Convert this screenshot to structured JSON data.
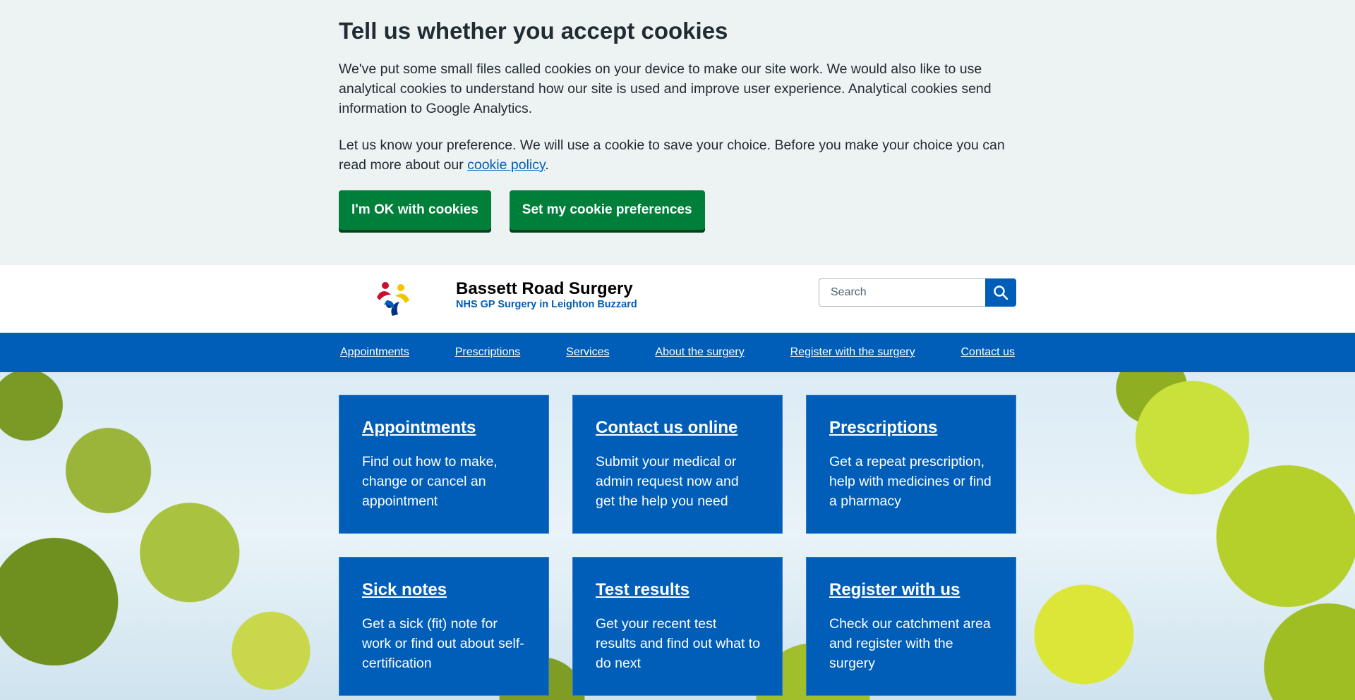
{
  "cookie_banner": {
    "title": "Tell us whether you accept cookies",
    "paragraph1": "We've put some small files called cookies on your device to make our site work. We would also like to use analytical cookies to understand how our site is used and improve user experience. Analytical cookies send information to Google Analytics.",
    "paragraph2_before": "Let us know your preference. We will use a cookie to save your choice. Before you make your choice you can read more about our ",
    "policy_link": "cookie policy",
    "paragraph2_after": ".",
    "accept_button": "I'm OK with cookies",
    "preferences_button": "Set my cookie preferences"
  },
  "header": {
    "title": "Bassett Road Surgery",
    "subtitle": "NHS GP Surgery in Leighton Buzzard",
    "search_placeholder": "Search",
    "logo_icon": "people-logo-icon",
    "search_icon": "search-icon"
  },
  "nav": {
    "items": [
      {
        "label": "Appointments"
      },
      {
        "label": "Prescriptions"
      },
      {
        "label": "Services"
      },
      {
        "label": "About the surgery"
      },
      {
        "label": "Register with the surgery"
      },
      {
        "label": "Contact us"
      }
    ]
  },
  "cards": [
    {
      "title": "Appointments",
      "text": "Find out how to make, change or cancel an appointment"
    },
    {
      "title": "Contact us online",
      "text": "Submit your medical or admin request now and get the help you need"
    },
    {
      "title": "Prescriptions",
      "text": "Get a repeat prescription, help with medicines or find a pharmacy"
    },
    {
      "title": "Sick notes",
      "text": "Get a sick (fit) note for work or find out about self-certification"
    },
    {
      "title": "Test results",
      "text": "Get your recent test results and find out what to do next"
    },
    {
      "title": "Register with us",
      "text": "Check our catchment area and register with the surgery"
    }
  ],
  "colors": {
    "nhs_blue": "#005eb8",
    "button_green": "#007f3b",
    "banner_bg": "#edf3f3"
  }
}
